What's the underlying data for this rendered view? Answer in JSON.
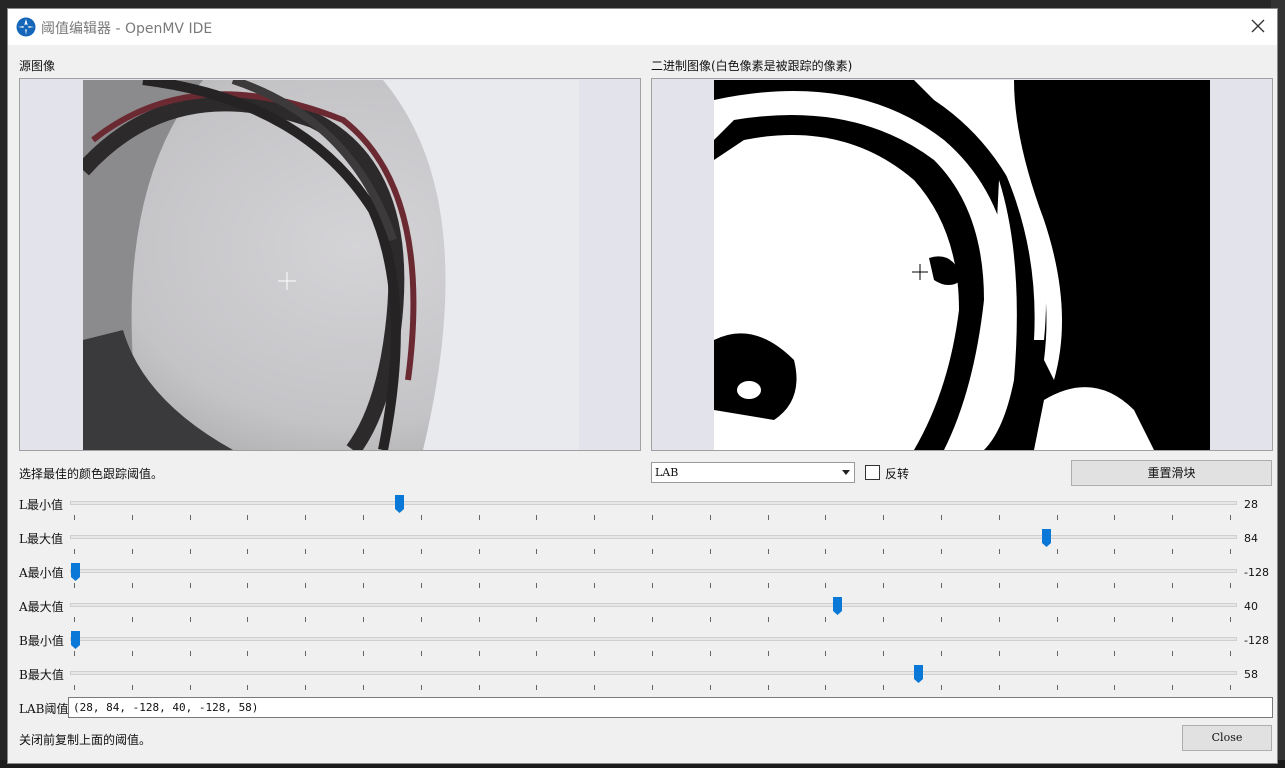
{
  "window": {
    "title": "阈值编辑器 - OpenMV IDE",
    "icon": "openmv-icon",
    "close_icon": "close-icon"
  },
  "source_image": {
    "label": "源图像"
  },
  "binary_image": {
    "label": "二进制图像(白色像素是被跟踪的像素)"
  },
  "instructions": "选择最佳的颜色跟踪阈值。",
  "color_space": {
    "selected": "LAB"
  },
  "invert": {
    "label": "反转",
    "checked": false
  },
  "reset_button": {
    "label": "重置滑块"
  },
  "sliders": [
    {
      "label": "L最小值",
      "value": "28",
      "min": 0,
      "max": 100,
      "level": 28
    },
    {
      "label": "L最大值",
      "value": "84",
      "min": 0,
      "max": 100,
      "level": 84
    },
    {
      "label": "A最小值",
      "value": "-128",
      "min": -128,
      "max": 127,
      "level": -128
    },
    {
      "label": "A最大值",
      "value": "40",
      "min": -128,
      "max": 127,
      "level": 40
    },
    {
      "label": "B最小值",
      "value": "-128",
      "min": -128,
      "max": 127,
      "level": -128
    },
    {
      "label": "B最大值",
      "value": "58",
      "min": -128,
      "max": 127,
      "level": 58
    }
  ],
  "lab_threshold": {
    "label": "LAB阈值",
    "value": "(28, 84, -128, 40, -128, 58)"
  },
  "footer_hint": "关闭前复制上面的阈值。",
  "close_button": {
    "label": "Close"
  },
  "colors": {
    "accent": "#0a78d7",
    "dialog_bg": "#f0f0f0",
    "image_frame_bg": "#e3e3ec"
  }
}
